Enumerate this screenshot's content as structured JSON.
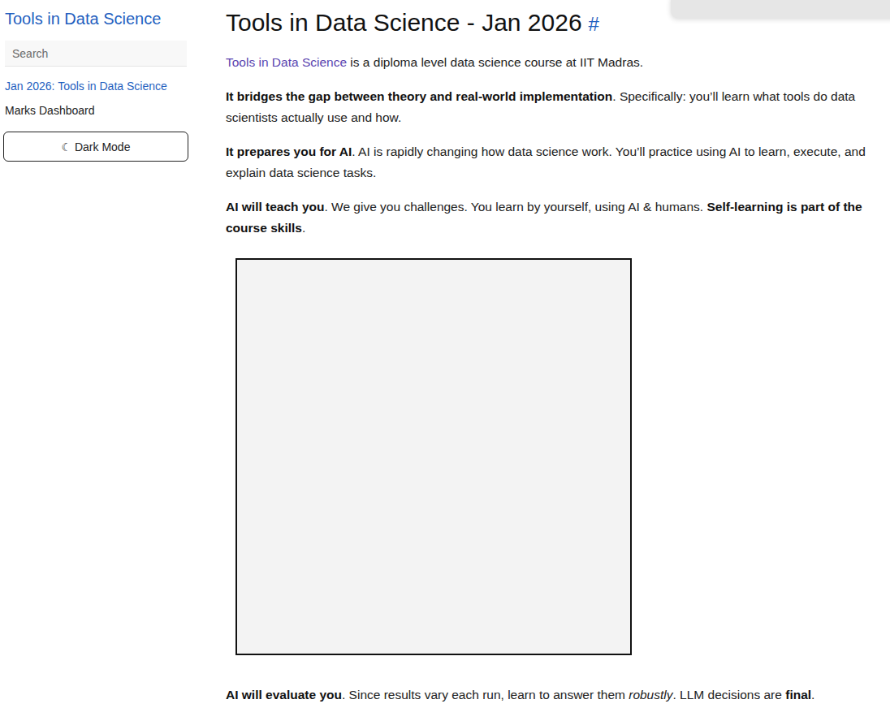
{
  "sidebar": {
    "title": "Tools in Data Science",
    "search": {
      "placeholder": "Search"
    },
    "items": [
      {
        "label": "Jan 2026: Tools in Data Science",
        "selected": true
      },
      {
        "label": "Marks Dashboard",
        "selected": false
      }
    ],
    "dark_mode_button": "☾ Dark Mode"
  },
  "page": {
    "heading": "Tools in Data Science - Jan 2026",
    "anchor": "#",
    "paragraphs_before": [
      [
        {
          "kind": "link",
          "text": "Tools in Data Science"
        },
        {
          "kind": "plain",
          "text": " is a diploma level data science course at IIT Madras."
        }
      ],
      [
        {
          "kind": "bold",
          "text": "It bridges the gap between theory and real-world implementation"
        },
        {
          "kind": "plain",
          "text": ". Specifically: you’ll learn what tools do data scientists actually use and how."
        }
      ],
      [
        {
          "kind": "bold",
          "text": "It prepares you for AI"
        },
        {
          "kind": "plain",
          "text": ". AI is rapidly changing how data science work. You’ll practice using AI to learn, execute, and explain data science tasks."
        }
      ],
      [
        {
          "kind": "bold",
          "text": "AI will teach you"
        },
        {
          "kind": "plain",
          "text": ". We give you challenges. You learn by yourself, using AI & humans. "
        },
        {
          "kind": "bold",
          "text": "Self-learning is part of the course skills"
        },
        {
          "kind": "plain",
          "text": "."
        }
      ]
    ],
    "paragraphs_after": [
      [
        {
          "kind": "bold",
          "text": "AI will evaluate you"
        },
        {
          "kind": "plain",
          "text": ". Since results vary each run, learn to answer them "
        },
        {
          "kind": "italic",
          "text": "robustly"
        },
        {
          "kind": "plain",
          "text": ". LLM decisions are "
        },
        {
          "kind": "bold",
          "text": "final"
        },
        {
          "kind": "plain",
          "text": "."
        }
      ]
    ]
  }
}
